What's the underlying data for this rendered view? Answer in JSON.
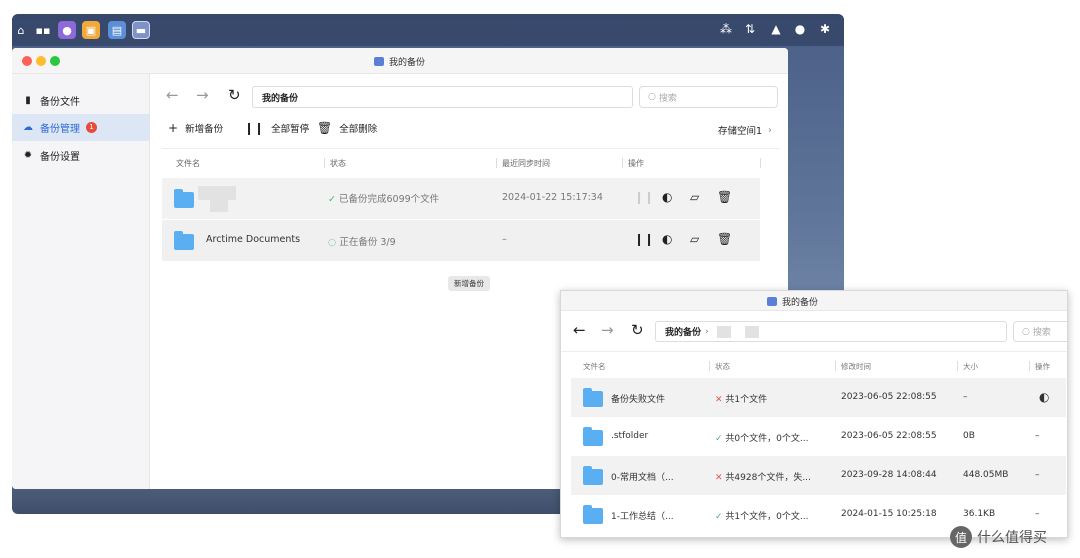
{
  "main_window": {
    "title": "我的备份",
    "sidebar": [
      {
        "label": "备份文件",
        "icon": "file-icon"
      },
      {
        "label": "备份管理",
        "icon": "cloud-icon",
        "badge": "1"
      },
      {
        "label": "备份设置",
        "icon": "gear-icon"
      }
    ],
    "path": "我的备份",
    "search_placeholder": "搜索",
    "toolbar": {
      "add_label": "新增备份",
      "pause_all_label": "全部暂停",
      "delete_all_label": "全部删除",
      "storage_label": "存储空间1"
    },
    "columns": [
      "文件名",
      "状态",
      "最近同步时间",
      "操作"
    ],
    "rows": [
      {
        "name": "",
        "status": "已备份完成6099个文件",
        "time": "2024-01-22 15:17:34"
      },
      {
        "name": "Arctime Documents",
        "status": "正在备份 3/9",
        "time": "–"
      }
    ],
    "tooltip": "新增备份"
  },
  "second_window": {
    "title": "我的备份",
    "path": "我的备份",
    "search_placeholder": "搜索",
    "columns": [
      "文件名",
      "状态",
      "修改时间",
      "大小",
      "操作"
    ],
    "rows": [
      {
        "name": "备份失败文件",
        "status": "共1个文件",
        "status_type": "error",
        "time": "2023-06-05 22:08:55",
        "size": "–",
        "action": "retry-icon"
      },
      {
        "name": ".stfolder",
        "status": "共0个文件，0个文...",
        "status_type": "ok",
        "time": "2023-06-05 22:08:55",
        "size": "0B",
        "action": "–"
      },
      {
        "name": "0-常用文档（...",
        "status": "共4928个文件，失...",
        "status_type": "error",
        "time": "2023-09-28 14:08:44",
        "size": "448.05MB",
        "action": "–"
      },
      {
        "name": "1-工作总结（...",
        "status": "共1个文件，0个文...",
        "status_type": "ok",
        "time": "2024-01-15 10:25:18",
        "size": "36.1KB",
        "action": "–"
      }
    ]
  },
  "watermark": "什么值得买",
  "colors": {
    "accent": "#2c6bd6",
    "folder": "#5aaef2",
    "error": "#e05a4b",
    "success": "#3db86a"
  }
}
